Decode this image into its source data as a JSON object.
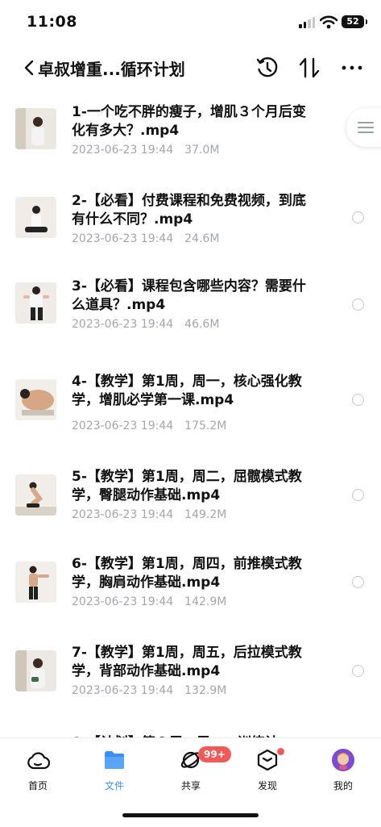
{
  "status_bar": {
    "time": "11:08",
    "battery": "52"
  },
  "header": {
    "title": "卓叔增重...循环计划",
    "back_icon": "chevron-left-icon",
    "history_icon": "history-clock-icon",
    "sort_icon": "sort-arrows-icon",
    "more_icon": "more-dots-icon"
  },
  "files": [
    {
      "name": "1-一个吃不胖的瘦子，增肌３个月后变化有多大？.mp4",
      "date": "2023-06-23 19:44",
      "size": "37.0M"
    },
    {
      "name": "2-【必看】付费课程和免费视频，到底有什么不同？.mp4",
      "date": "2023-06-23 19:44",
      "size": "24.6M"
    },
    {
      "name": "3-【必看】课程包含哪些内容？需要什么道具？.mp4",
      "date": "2023-06-23 19:44",
      "size": "46.6M"
    },
    {
      "name": "4-【教学】第1周，周一，核心强化教学，增肌必学第一课.mp4",
      "date": "2023-06-23 19:44",
      "size": "175.2M"
    },
    {
      "name": "5-【教学】第1周，周二，屈髋模式教学，臀腿动作基础.mp4",
      "date": "2023-06-23 19:44",
      "size": "149.2M"
    },
    {
      "name": "6-【教学】第1周，周四，前推模式教学，胸肩动作基础.mp4",
      "date": "2023-06-23 19:44",
      "size": "142.9M"
    },
    {
      "name": "7-【教学】第1周，周五，后拉模式教学，背部动作基础.mp4",
      "date": "2023-06-23 19:44",
      "size": "132.9M"
    },
    {
      "name": "8-【计划】第２周，周一，训练计"
    }
  ],
  "tabs": [
    {
      "label": "首页",
      "icon": "cloud-icon"
    },
    {
      "label": "文件",
      "icon": "folder-icon"
    },
    {
      "label": "共享",
      "icon": "share-orbit-icon",
      "badge": "99+"
    },
    {
      "label": "发现",
      "icon": "cube-icon"
    },
    {
      "label": "我的",
      "icon": "avatar-icon"
    }
  ],
  "colors": {
    "accent": "#3c8ef5",
    "badge": "#f25a5a",
    "meta": "#a3a6ab"
  }
}
